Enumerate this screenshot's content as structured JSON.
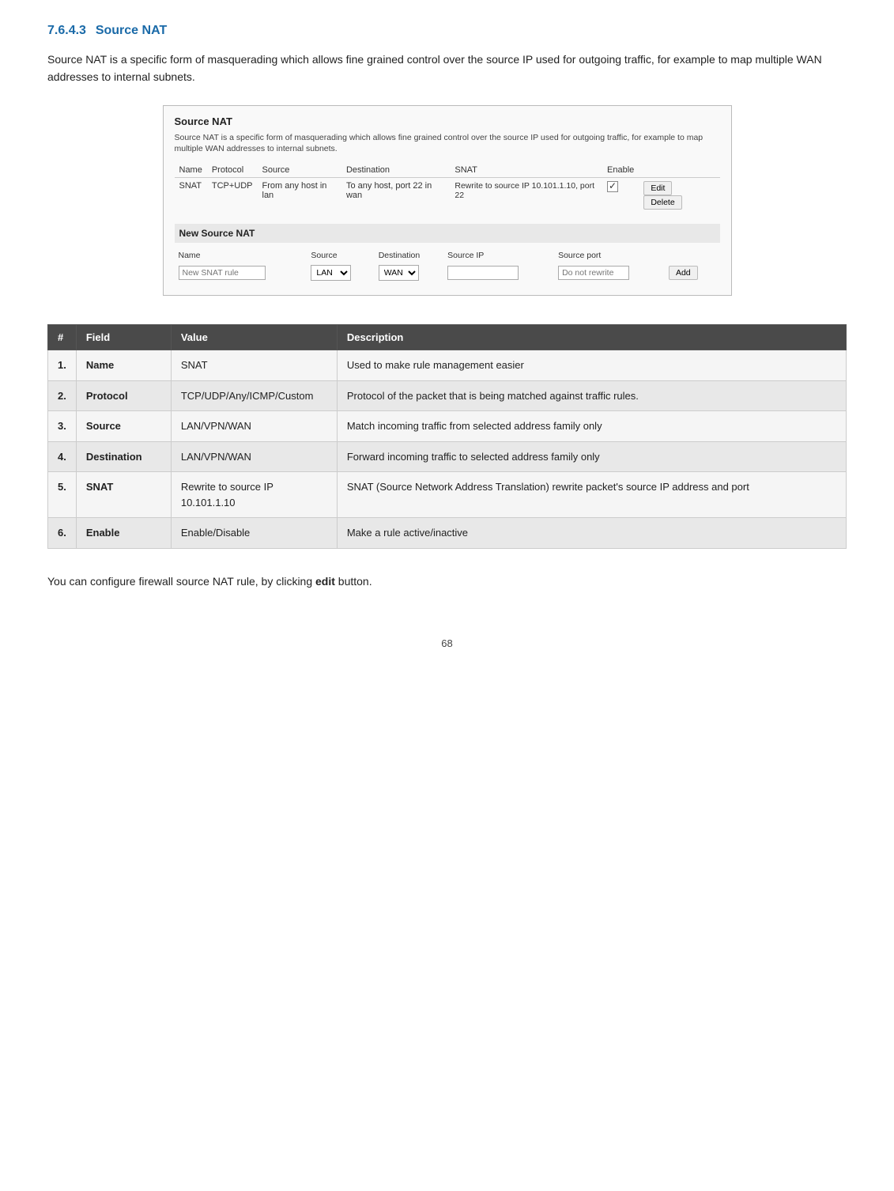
{
  "heading": {
    "number": "7.6.4.3",
    "title": "Source NAT",
    "color": "#1a6aa8"
  },
  "intro": "Source NAT is a specific form of masquerading which allows fine grained control over the source IP used for outgoing traffic, for example to map multiple WAN addresses to internal subnets.",
  "ui_box": {
    "title": "Source NAT",
    "description": "Source NAT is a specific form of masquerading which allows fine grained control over the source IP used for outgoing traffic, for example to map multiple WAN addresses to internal subnets.",
    "existing_table": {
      "columns": [
        "Name",
        "Protocol",
        "Source",
        "Destination",
        "SNAT",
        "Enable"
      ],
      "rows": [
        {
          "name": "SNAT",
          "protocol": "TCP+UDP",
          "source": "From any host in lan",
          "destination": "To any host, port 22 in wan",
          "snat": "Rewrite to source IP 10.101.1.10, port 22",
          "enable": true
        }
      ]
    },
    "new_section": {
      "title": "New Source NAT",
      "columns": [
        "Name",
        "Source",
        "Destination",
        "Source IP",
        "Source port"
      ],
      "name_placeholder": "New SNAT rule",
      "source_default": "LAN",
      "destination_default": "WAN",
      "source_ip_placeholder": "",
      "source_port_placeholder": "Do not rewrite",
      "add_button": "Add"
    }
  },
  "data_table": {
    "columns": [
      "#",
      "Field",
      "Value",
      "Description"
    ],
    "rows": [
      {
        "num": "1.",
        "field": "Name",
        "value": "SNAT",
        "description": "Used to make rule management easier"
      },
      {
        "num": "2.",
        "field": "Protocol",
        "value": "TCP/UDP/Any/ICMP/Custom",
        "description": "Protocol of the packet that is being matched against traffic rules."
      },
      {
        "num": "3.",
        "field": "Source",
        "value": "LAN/VPN/WAN",
        "description": "Match incoming traffic from selected address family only"
      },
      {
        "num": "4.",
        "field": "Destination",
        "value": "LAN/VPN/WAN",
        "description": "Forward incoming traffic to selected address family only"
      },
      {
        "num": "5.",
        "field": "SNAT",
        "value": "Rewrite to source IP 10.101.1.10",
        "description": "SNAT (Source Network Address Translation) rewrite packet\\'s source IP address and port"
      },
      {
        "num": "6.",
        "field": "Enable",
        "value": "Enable/Disable",
        "description": "Make a rule active/inactive"
      }
    ]
  },
  "outro": {
    "prefix": "You can configure firewall source NAT rule, by clicking ",
    "bold": "edit",
    "suffix": " button."
  },
  "page_number": "68"
}
